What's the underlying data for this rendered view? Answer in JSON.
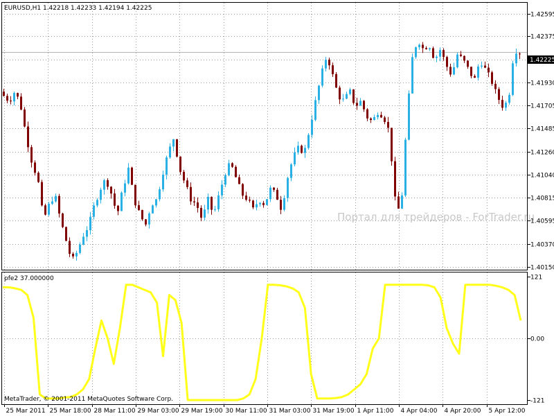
{
  "main_chart": {
    "symbol_info": "EURUSD,H1  1.42218 1.42233 1.42194 1.42225",
    "current_price_label": "1.42225",
    "y_tick_labels": [
      "1.42595",
      "1.42375",
      "1.42150",
      "1.41930",
      "1.41705",
      "1.41485",
      "1.41260",
      "1.41040",
      "1.40815",
      "1.40595",
      "1.40370",
      "1.40150"
    ],
    "watermark": "Портал для трейдеров - ForTrader.ru",
    "colors": {
      "bull": "#29b0e4",
      "bear": "#800000",
      "grid": "#9a9a9a",
      "axis": "#000000",
      "price_line": "#b4b4b4"
    }
  },
  "indicator": {
    "label": "pfe2 37.000000",
    "y_tick_labels": [
      "121",
      "0.00",
      "-121"
    ],
    "copyright": "MetaTrader, © 2001-2011 MetaQuotes Software Corp.",
    "color": "#ffff1a"
  },
  "x_axis": {
    "tick_labels": [
      "25 Mar 2011",
      "25 Mar 18:00",
      "28 Mar 11:00",
      "29 Mar 03:00",
      "29 Mar 19:00",
      "30 Mar 11:00",
      "31 Mar 03:00",
      "31 Mar 19:00",
      "1 Apr 11:00",
      "4 Apr 04:00",
      "4 Apr 20:00",
      "5 Apr 12:00"
    ]
  },
  "chart_data": [
    {
      "type": "candlestick",
      "title": "EURUSD,H1",
      "ylim": [
        1.4012,
        1.427
      ],
      "x": [
        "25 Mar 2011",
        "25 Mar 18:00",
        "28 Mar 11:00",
        "29 Mar 03:00",
        "29 Mar 19:00",
        "30 Mar 11:00",
        "31 Mar 03:00",
        "31 Mar 19:00",
        "1 Apr 11:00",
        "4 Apr 04:00",
        "4 Apr 20:00",
        "5 Apr 12:00"
      ],
      "close_path": [
        1.418,
        1.4175,
        1.4185,
        1.417,
        1.414,
        1.4115,
        1.41,
        1.406,
        1.4075,
        1.4085,
        1.406,
        1.404,
        1.402,
        1.403,
        1.4045,
        1.4055,
        1.4075,
        1.409,
        1.41,
        1.4085,
        1.4065,
        1.409,
        1.411,
        1.408,
        1.4065,
        1.4055,
        1.4075,
        1.408,
        1.4105,
        1.4125,
        1.414,
        1.411,
        1.4095,
        1.408,
        1.4075,
        1.406,
        1.408,
        1.4065,
        1.4085,
        1.4105,
        1.4115,
        1.41,
        1.4085,
        1.408,
        1.407,
        1.408,
        1.4075,
        1.409,
        1.4085,
        1.407,
        1.41,
        1.412,
        1.413,
        1.4125,
        1.415,
        1.4175,
        1.42,
        1.422,
        1.42,
        1.418,
        1.4175,
        1.4185,
        1.417,
        1.4175,
        1.416,
        1.4155,
        1.4165,
        1.416,
        1.4145,
        1.408,
        1.4065,
        1.415,
        1.4215,
        1.4235,
        1.4225,
        1.423,
        1.4215,
        1.4225,
        1.421,
        1.42,
        1.422,
        1.4215,
        1.4205,
        1.4195,
        1.4215,
        1.4205,
        1.4195,
        1.418,
        1.417,
        1.4175,
        1.4225,
        1.4222
      ],
      "last_price": 1.42225
    },
    {
      "type": "line",
      "title": "pfe2 37.000000",
      "ylim": [
        -121,
        121
      ],
      "series": [
        {
          "name": "pfe2 37.000000",
          "values": [
            100,
            100,
            98,
            95,
            85,
            40,
            -110,
            -118,
            -118,
            -118,
            -116,
            -115,
            -110,
            -100,
            -80,
            -20,
            35,
            0,
            -50,
            20,
            105,
            105,
            100,
            95,
            90,
            70,
            -35,
            85,
            75,
            30,
            -121,
            -121,
            -121,
            -121,
            -121,
            -121,
            -121,
            -121,
            -121,
            -118,
            -110,
            -80,
            0,
            105,
            105,
            104,
            102,
            98,
            90,
            60,
            -70,
            -118,
            -118,
            -118,
            -117,
            -115,
            -110,
            -100,
            -90,
            -70,
            -20,
            0,
            105,
            105,
            105,
            105,
            105,
            105,
            105,
            104,
            100,
            80,
            20,
            -10,
            -30,
            105,
            105,
            105,
            105,
            105,
            103,
            100,
            95,
            85,
            35
          ]
        }
      ]
    }
  ]
}
